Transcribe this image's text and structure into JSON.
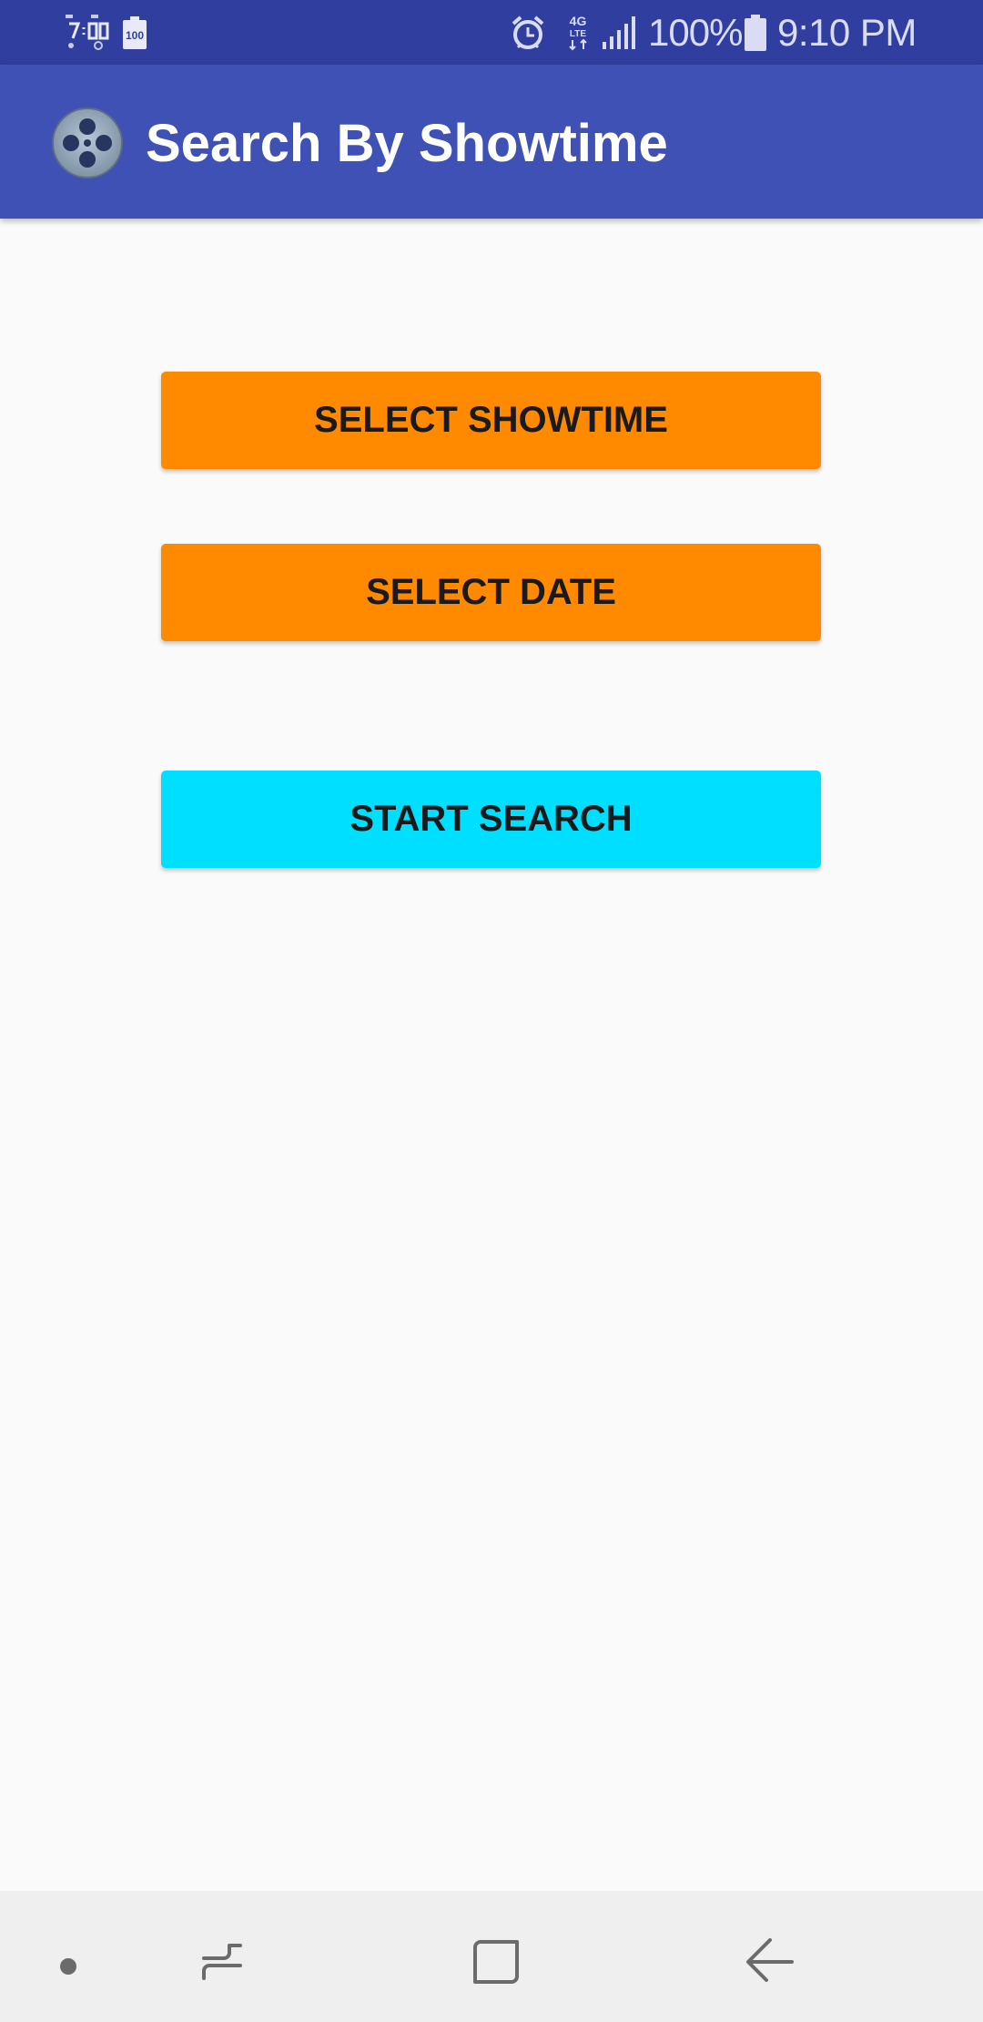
{
  "status_bar": {
    "time": "9:10 PM",
    "battery_percent": "100%",
    "network_label": "4G LTE",
    "left_icons": [
      "clock-widget-icon",
      "battery-saver-icon"
    ],
    "right_icons": [
      "alarm-icon",
      "lte-icon",
      "signal-icon",
      "battery-icon"
    ]
  },
  "app_bar": {
    "title": "Search By Showtime",
    "logo_icon": "film-reel-icon"
  },
  "buttons": {
    "select_showtime": "SELECT SHOWTIME",
    "select_date": "SELECT DATE",
    "start_search": "START SEARCH"
  },
  "nav_bar": {
    "icons": [
      "nav-dot-icon",
      "recents-icon",
      "home-icon",
      "back-icon"
    ]
  },
  "colors": {
    "status_bar": "#303f9f",
    "app_bar": "#3f51b5",
    "primary_button": "#ff8a00",
    "search_button": "#00dfff",
    "background": "#fafafa",
    "nav_bar": "#efefef"
  }
}
